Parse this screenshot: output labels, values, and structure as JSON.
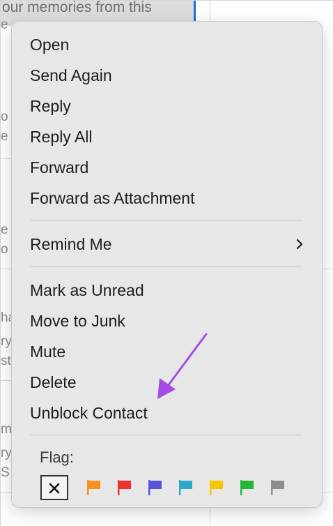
{
  "background": {
    "selected_snippet": "our memories from this",
    "fragments": [
      "e",
      "o",
      "e",
      "e",
      "o",
      "ha",
      "ry",
      "st",
      "m",
      "ry",
      "S"
    ]
  },
  "menu": {
    "items": [
      {
        "label": "Open"
      },
      {
        "label": "Send Again"
      },
      {
        "label": "Reply"
      },
      {
        "label": "Reply All"
      },
      {
        "label": "Forward"
      },
      {
        "label": "Forward as Attachment"
      },
      {
        "label": "Remind Me",
        "has_submenu": true
      },
      {
        "label": "Mark as Unread"
      },
      {
        "label": "Move to Junk"
      },
      {
        "label": "Mute"
      },
      {
        "label": "Delete"
      },
      {
        "label": "Unblock Contact"
      }
    ],
    "flag_label": "Flag:",
    "flag_colors": [
      {
        "name": "orange",
        "hex": "#f7901e"
      },
      {
        "name": "red",
        "hex": "#f0312b"
      },
      {
        "name": "purple",
        "hex": "#5856d6"
      },
      {
        "name": "blue",
        "hex": "#2ba8c9"
      },
      {
        "name": "yellow",
        "hex": "#f7c600"
      },
      {
        "name": "green",
        "hex": "#26b636"
      },
      {
        "name": "gray",
        "hex": "#8e8e8e"
      }
    ]
  },
  "annotation": {
    "color": "#a44be6"
  }
}
